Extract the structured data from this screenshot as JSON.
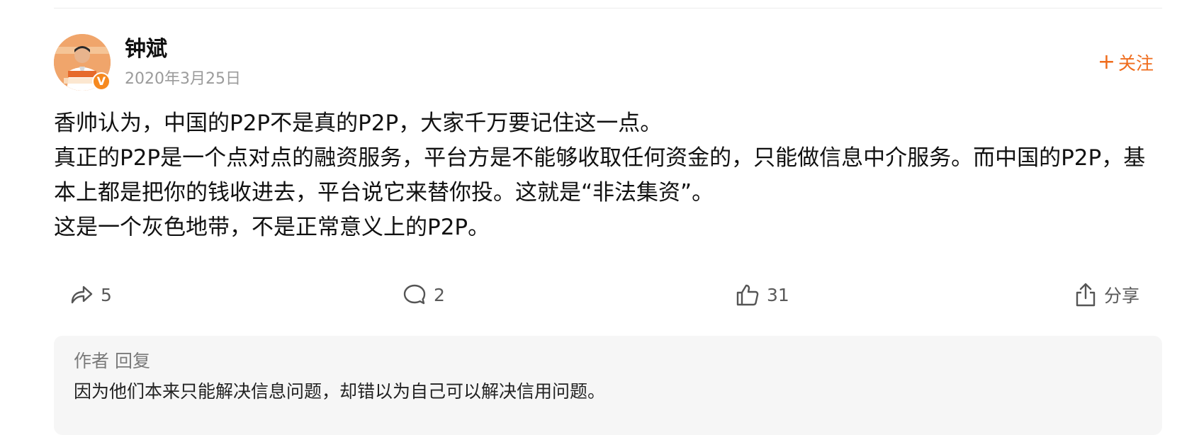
{
  "author": {
    "name": "钟斌",
    "date": "2020年3月25日",
    "avatar_icon": "person-photo",
    "verified_icon": "verified-v-badge",
    "verified_glyph": "V"
  },
  "follow": {
    "plus": "+",
    "label": "关注"
  },
  "post": {
    "paragraphs": [
      "香帅认为，中国的P2P不是真的P2P，大家千万要记住这一点。",
      "真正的P2P是一个点对点的融资服务，平台方是不能够收取任何资金的，只能做信息中介服务。而中国的P2P，基本上都是把你的钱收进去，平台说它来替你投。这就是“非法集资”。",
      "这是一个灰色地带，不是正常意义上的P2P。"
    ]
  },
  "actions": {
    "repost": {
      "icon": "forward-arrow-icon",
      "count": "5"
    },
    "comment": {
      "icon": "comment-bubble-icon",
      "count": "2"
    },
    "like": {
      "icon": "thumbs-up-icon",
      "count": "31"
    },
    "share": {
      "icon": "share-upload-icon",
      "label": "分享"
    }
  },
  "reply": {
    "label": "作者 回复",
    "text": "因为他们本来只能解决信息问题，却错以为自己可以解决信用问题。"
  },
  "colors": {
    "accent": "#ef6c1c",
    "badge": "#f6891f",
    "muted_text": "#9b9b9b",
    "reply_bg": "#f6f6f6"
  }
}
